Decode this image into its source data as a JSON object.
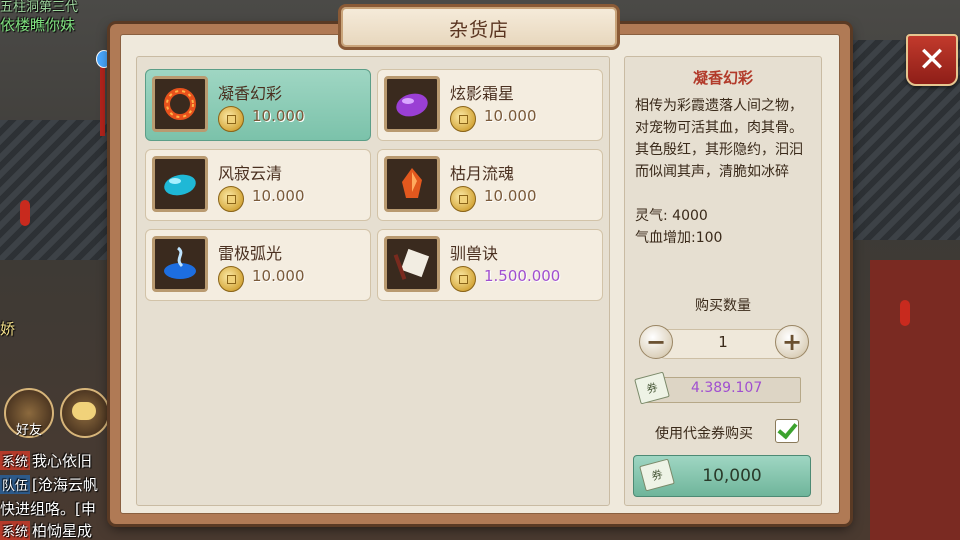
{
  "background": {
    "chat_top": [
      "五柱洞第三代",
      "依楼瞧你妹"
    ],
    "side_name": "娇",
    "friend_label": "好友",
    "chat_lines": [
      {
        "tag": "系统",
        "text": "我心依旧"
      },
      {
        "tag": "队伍",
        "text": "[沧海云帆"
      },
      {
        "tag": "",
        "text": "快进组咯。[申"
      },
      {
        "tag": "系统",
        "text": "柏恸星成"
      }
    ]
  },
  "shop": {
    "title": "杂货店",
    "close_icon": "close-x-icon",
    "items": [
      {
        "name": "凝香幻彩",
        "price": "10.000",
        "icon": "fire-ring-icon",
        "selected": true
      },
      {
        "name": "炫影霜星",
        "price": "10.000",
        "icon": "purple-gem-icon",
        "selected": false
      },
      {
        "name": "风寂云清",
        "price": "10.000",
        "icon": "cyan-gem-icon",
        "selected": false
      },
      {
        "name": "枯月流魂",
        "price": "10.000",
        "icon": "orange-crystal-icon",
        "selected": false
      },
      {
        "name": "雷极弧光",
        "price": "10.000",
        "icon": "blue-lightning-icon",
        "selected": false
      },
      {
        "name": "驯兽诀",
        "price": "1.500.000",
        "icon": "scroll-icon",
        "selected": false
      }
    ]
  },
  "detail": {
    "title": "凝香幻彩",
    "description": "相传为彩霞遗落人间之物，对宠物可活其血，肉其骨。其色殷红，其形隐约，汩汩而似闻其声，清脆如冰碎",
    "stat1": "灵气: 4000",
    "stat2": "气血增加:100",
    "qty_label": "购买数量",
    "qty_value": "1",
    "minus": "−",
    "plus": "+",
    "voucher_glyph": "券",
    "balance": "4.389.107",
    "use_voucher_label": "使用代金券购买",
    "use_voucher_checked": true,
    "buy_label": "10,000"
  },
  "colors": {
    "selected_item": "#7bc2aa",
    "price_purple": "#a04fd0",
    "detail_title_red": "#b23a2a",
    "close_red": "#c23a2c"
  }
}
